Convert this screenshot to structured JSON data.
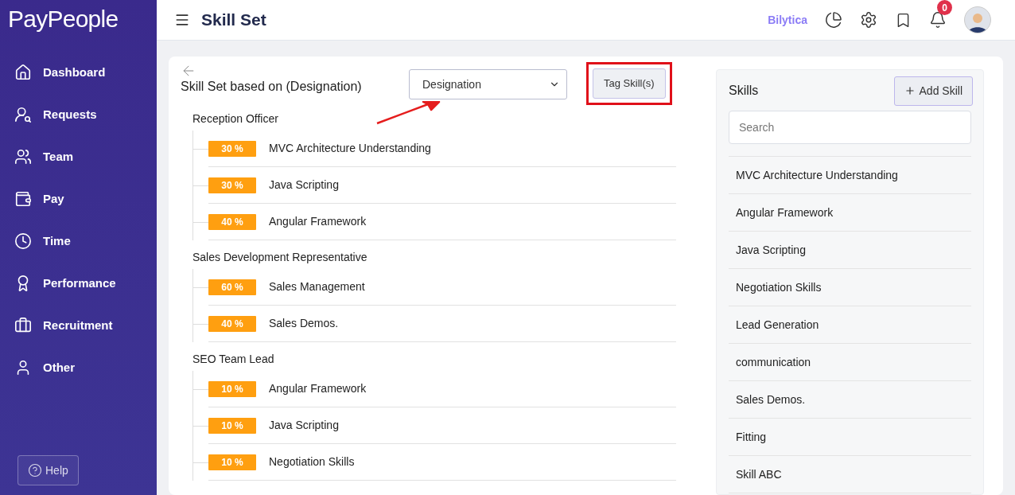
{
  "brand": {
    "logo": "PayPeople"
  },
  "sidebar": {
    "items": [
      {
        "label": "Dashboard",
        "kind": "home",
        "selected": false
      },
      {
        "label": "Requests",
        "kind": "requests",
        "selected": false
      },
      {
        "label": "Team",
        "kind": "team",
        "selected": false
      },
      {
        "label": "Pay",
        "kind": "pay",
        "selected": false
      },
      {
        "label": "Time",
        "kind": "time",
        "selected": false
      },
      {
        "label": "Performance",
        "kind": "performance",
        "selected": false
      },
      {
        "label": "Recruitment",
        "kind": "recruitment",
        "selected": false
      },
      {
        "label": "Other",
        "kind": "other",
        "selected": false
      }
    ],
    "help": "Help"
  },
  "header": {
    "title": "Skill Set",
    "company": "Bilytica",
    "notifications": "0"
  },
  "main": {
    "heading": "Skill Set based on (Designation)",
    "filter": {
      "value": "Designation"
    },
    "tag_button": "Tag Skill(s)",
    "groups": [
      {
        "title": "Reception Officer",
        "skills": [
          {
            "percent": "30 %",
            "name": "MVC Architecture Understanding"
          },
          {
            "percent": "30 %",
            "name": "Java Scripting"
          },
          {
            "percent": "40 %",
            "name": "Angular Framework"
          }
        ]
      },
      {
        "title": "Sales Development Representative",
        "skills": [
          {
            "percent": "60 %",
            "name": "Sales Management"
          },
          {
            "percent": "40 %",
            "name": "Sales Demos."
          }
        ]
      },
      {
        "title": "SEO Team Lead",
        "skills": [
          {
            "percent": "10 %",
            "name": "Angular Framework"
          },
          {
            "percent": "10 %",
            "name": "Java Scripting"
          },
          {
            "percent": "10 %",
            "name": "Negotiation Skills"
          }
        ]
      }
    ]
  },
  "skills_panel": {
    "title": "Skills",
    "add_button": "Add Skill",
    "search": {
      "placeholder": "Search"
    },
    "items": [
      "MVC Architecture Understanding",
      "Angular Framework",
      "Java Scripting",
      "Negotiation Skills",
      "Lead Generation",
      "communication",
      "Sales Demos.",
      "Fitting",
      "Skill ABC"
    ]
  }
}
